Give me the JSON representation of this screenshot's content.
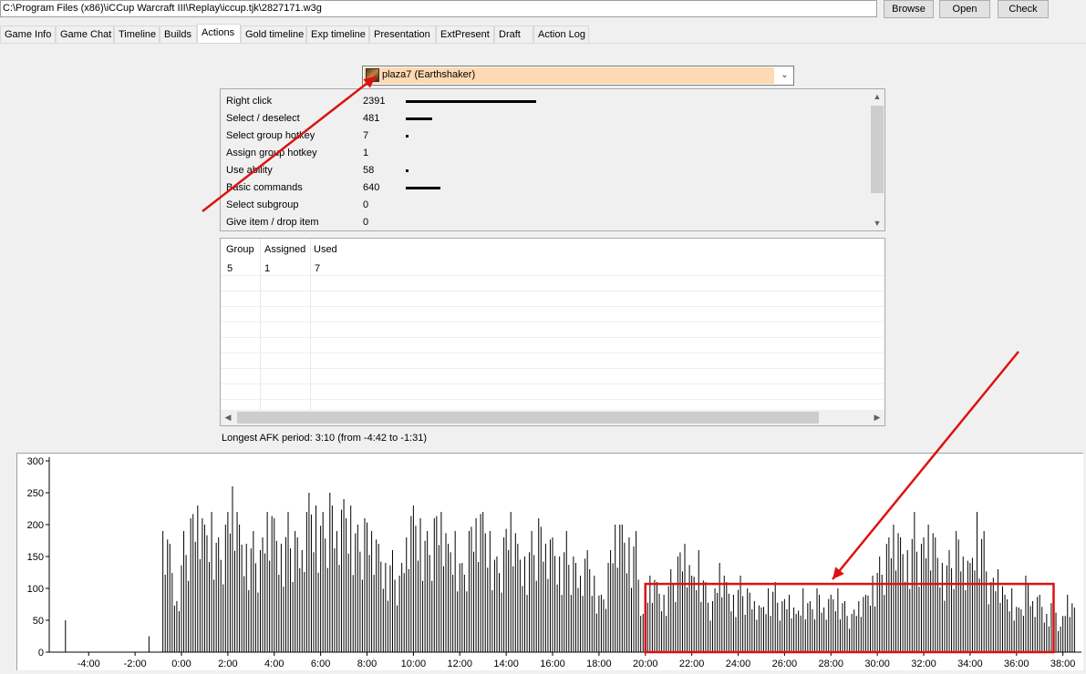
{
  "toolbar": {
    "path": "C:\\Program Files (x86)\\iCCup Warcraft III\\Replay\\iccup.tjk\\2827171.w3g",
    "browse_label": "Browse",
    "open_label": "Open",
    "check_label": "Check"
  },
  "tabs": [
    {
      "label": "Game Info"
    },
    {
      "label": "Game Chat"
    },
    {
      "label": "Timeline"
    },
    {
      "label": "Builds"
    },
    {
      "label": "Actions"
    },
    {
      "label": "Gold timeline"
    },
    {
      "label": "Exp timeline"
    },
    {
      "label": "Presentation"
    },
    {
      "label": "ExtPresent"
    },
    {
      "label": "Draft"
    },
    {
      "label": "Action Log"
    }
  ],
  "active_tab": "Actions",
  "player_select": {
    "selected": "plaza7 (Earthshaker)",
    "color": "#ffd9b3"
  },
  "actions": [
    {
      "name": "Right click",
      "count": 2391
    },
    {
      "name": "Select / deselect",
      "count": 481
    },
    {
      "name": "Select group hotkey",
      "count": 7
    },
    {
      "name": "Assign group hotkey",
      "count": 1
    },
    {
      "name": "Use ability",
      "count": 58
    },
    {
      "name": "Basic commands",
      "count": 640
    },
    {
      "name": "Select subgroup",
      "count": 0
    },
    {
      "name": "Give item / drop item",
      "count": 0
    }
  ],
  "group_table": {
    "headers": [
      "Group",
      "Assigned",
      "Used"
    ],
    "rows": [
      [
        "5",
        "1",
        "7"
      ]
    ]
  },
  "afk_text": "Longest AFK period: 3:10 (from -4:42 to -1:31)",
  "annotation_color": "#dd1111",
  "chart_data": {
    "type": "bar",
    "ylim": [
      0,
      300
    ],
    "yticks": [
      0,
      50,
      100,
      150,
      200,
      250,
      300
    ],
    "xlim": [
      -5.7,
      38.8
    ],
    "xticks": [
      -4,
      -2,
      0,
      2,
      4,
      6,
      8,
      10,
      12,
      14,
      16,
      18,
      20,
      22,
      24,
      26,
      28,
      30,
      32,
      34,
      36,
      38
    ],
    "xtick_labels": [
      "-4:00",
      "-2:00",
      "0:00",
      "2:00",
      "4:00",
      "6:00",
      "8:00",
      "10:00",
      "12:00",
      "14:00",
      "16:00",
      "18:00",
      "20:00",
      "22:00",
      "24:00",
      "26:00",
      "28:00",
      "30:00",
      "32:00",
      "34:00",
      "36:00",
      "38:00"
    ],
    "highlight_range": {
      "x": [
        20.0,
        37.6
      ],
      "y": [
        0,
        107
      ]
    },
    "bar_color": "#000000",
    "x": [
      -5.0,
      -4.7,
      -4.4,
      -4.1,
      -3.8,
      -3.5,
      -3.2,
      -2.9,
      -2.6,
      -2.3,
      -2.0,
      -1.7,
      -1.4,
      -1.1,
      -0.8,
      -0.5,
      -0.2,
      0.1,
      0.4,
      0.7,
      1.0,
      1.3,
      1.6,
      1.9,
      2.2,
      2.5,
      2.8,
      3.1,
      3.4,
      3.7,
      4.0,
      4.3,
      4.6,
      4.9,
      5.2,
      5.5,
      5.8,
      6.1,
      6.4,
      6.7,
      7.0,
      7.3,
      7.6,
      7.9,
      8.2,
      8.5,
      8.8,
      9.1,
      9.4,
      9.7,
      10.0,
      10.3,
      10.6,
      10.9,
      11.2,
      11.5,
      11.8,
      12.1,
      12.4,
      12.7,
      13.0,
      13.3,
      13.6,
      13.9,
      14.2,
      14.5,
      14.8,
      15.1,
      15.4,
      15.7,
      16.0,
      16.3,
      16.6,
      16.9,
      17.2,
      17.5,
      17.8,
      18.1,
      18.4,
      18.7,
      19.0,
      19.3,
      19.6,
      19.9,
      20.2,
      20.5,
      20.8,
      21.1,
      21.4,
      21.7,
      22.0,
      22.3,
      22.6,
      22.9,
      23.2,
      23.5,
      23.8,
      24.1,
      24.4,
      24.7,
      25.0,
      25.3,
      25.6,
      25.9,
      26.2,
      26.5,
      26.8,
      27.1,
      27.4,
      27.7,
      28.0,
      28.3,
      28.6,
      28.9,
      29.2,
      29.5,
      29.8,
      30.1,
      30.4,
      30.7,
      31.0,
      31.3,
      31.6,
      31.9,
      32.2,
      32.5,
      32.8,
      33.1,
      33.4,
      33.7,
      34.0,
      34.3,
      34.6,
      34.9,
      35.2,
      35.5,
      35.8,
      36.1,
      36.4,
      36.7,
      37.0,
      37.3,
      37.6,
      37.9,
      38.2,
      38.5
    ],
    "values": [
      50,
      0,
      0,
      0,
      0,
      0,
      0,
      0,
      0,
      0,
      0,
      0,
      25,
      0,
      190,
      170,
      80,
      190,
      210,
      230,
      200,
      220,
      180,
      200,
      260,
      200,
      170,
      190,
      160,
      220,
      210,
      170,
      220,
      190,
      160,
      250,
      230,
      220,
      250,
      190,
      240,
      230,
      200,
      210,
      190,
      170,
      140,
      160,
      120,
      180,
      230,
      210,
      190,
      210,
      220,
      170,
      190,
      140,
      190,
      210,
      220,
      190,
      150,
      180,
      220,
      170,
      150,
      190,
      210,
      170,
      180,
      150,
      190,
      150,
      120,
      160,
      120,
      90,
      140,
      200,
      200,
      180,
      190,
      60,
      120,
      110,
      90,
      130,
      150,
      170,
      120,
      160,
      110,
      80,
      140,
      110,
      90,
      120,
      100,
      80,
      70,
      100,
      110,
      80,
      90,
      60,
      100,
      80,
      100,
      70,
      90,
      100,
      80,
      60,
      80,
      90,
      120,
      150,
      170,
      200,
      180,
      160,
      220,
      170,
      200,
      180,
      140,
      160,
      190,
      150,
      140,
      220,
      190,
      110,
      130,
      90,
      100,
      70,
      120,
      80,
      90,
      60,
      100,
      40,
      90,
      70
    ]
  }
}
